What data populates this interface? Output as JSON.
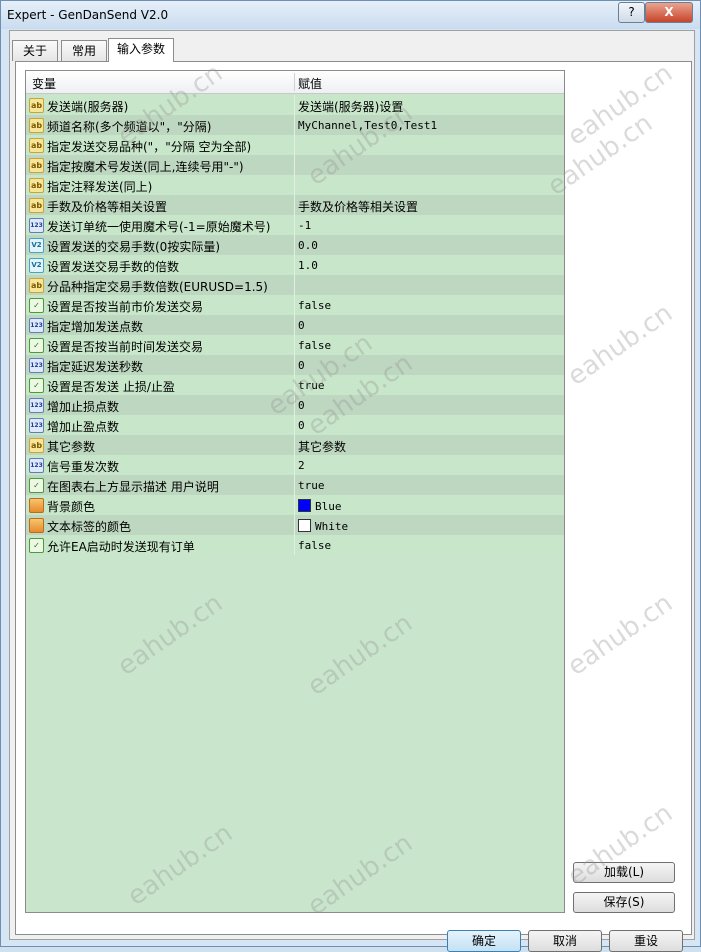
{
  "window": {
    "title": "Expert - GenDanSend V2.0",
    "help_label": "?",
    "close_label": "X"
  },
  "tabs": [
    {
      "label": "关于"
    },
    {
      "label": "常用"
    },
    {
      "label": "输入参数",
      "active": true
    }
  ],
  "grid": {
    "col_variable": "变量",
    "col_value": "赋值",
    "rows": [
      {
        "icon": "ab",
        "name": "发送端(服务器)",
        "value": "发送端(服务器)设置"
      },
      {
        "icon": "ab",
        "name": "频道名称(多个频道以\"，\"分隔)",
        "value": "MyChannel,Test0,Test1"
      },
      {
        "icon": "ab",
        "name": "指定发送交易品种(\"，\"分隔 空为全部)",
        "value": ""
      },
      {
        "icon": "ab",
        "name": "指定按魔术号发送(同上,连续号用\"-\")",
        "value": ""
      },
      {
        "icon": "ab",
        "name": "指定注释发送(同上)",
        "value": ""
      },
      {
        "icon": "ab",
        "name": "手数及价格等相关设置",
        "value": "手数及价格等相关设置"
      },
      {
        "icon": "123",
        "name": "发送订单统一使用魔术号(-1=原始魔术号)",
        "value": "-1"
      },
      {
        "icon": "v2",
        "name": "设置发送的交易手数(0按实际量)",
        "value": "0.0"
      },
      {
        "icon": "v2",
        "name": "设置发送交易手数的倍数",
        "value": "1.0"
      },
      {
        "icon": "ab",
        "name": "分品种指定交易手数倍数(EURUSD=1.5)",
        "value": ""
      },
      {
        "icon": "bool",
        "name": "设置是否按当前市价发送交易",
        "value": "false"
      },
      {
        "icon": "123",
        "name": "指定增加发送点数",
        "value": "0"
      },
      {
        "icon": "bool",
        "name": "设置是否按当前时间发送交易",
        "value": "false"
      },
      {
        "icon": "123",
        "name": "指定延迟发送秒数",
        "value": "0"
      },
      {
        "icon": "bool",
        "name": "设置是否发送 止损/止盈",
        "value": "true"
      },
      {
        "icon": "123",
        "name": "增加止损点数",
        "value": "0"
      },
      {
        "icon": "123",
        "name": "增加止盈点数",
        "value": "0"
      },
      {
        "icon": "ab",
        "name": "其它参数",
        "value": "其它参数"
      },
      {
        "icon": "123",
        "name": "信号重发次数",
        "value": "2"
      },
      {
        "icon": "bool",
        "name": "在图表右上方显示描述 用户说明",
        "value": "true"
      },
      {
        "icon": "color",
        "name": "背景颜色",
        "value": "Blue",
        "swatch": "#0000ff"
      },
      {
        "icon": "color",
        "name": "文本标签的颜色",
        "value": "White",
        "swatch": "#ffffff"
      },
      {
        "icon": "bool",
        "name": "允许EA启动时发送现有订单",
        "value": "false"
      }
    ]
  },
  "side_buttons": {
    "load_label": "加载(L)",
    "save_label": "保存(S)"
  },
  "bottom_buttons": {
    "ok_label": "确定",
    "cancel_label": "取消",
    "reset_label": "重设"
  },
  "watermark": "eahub.cn"
}
